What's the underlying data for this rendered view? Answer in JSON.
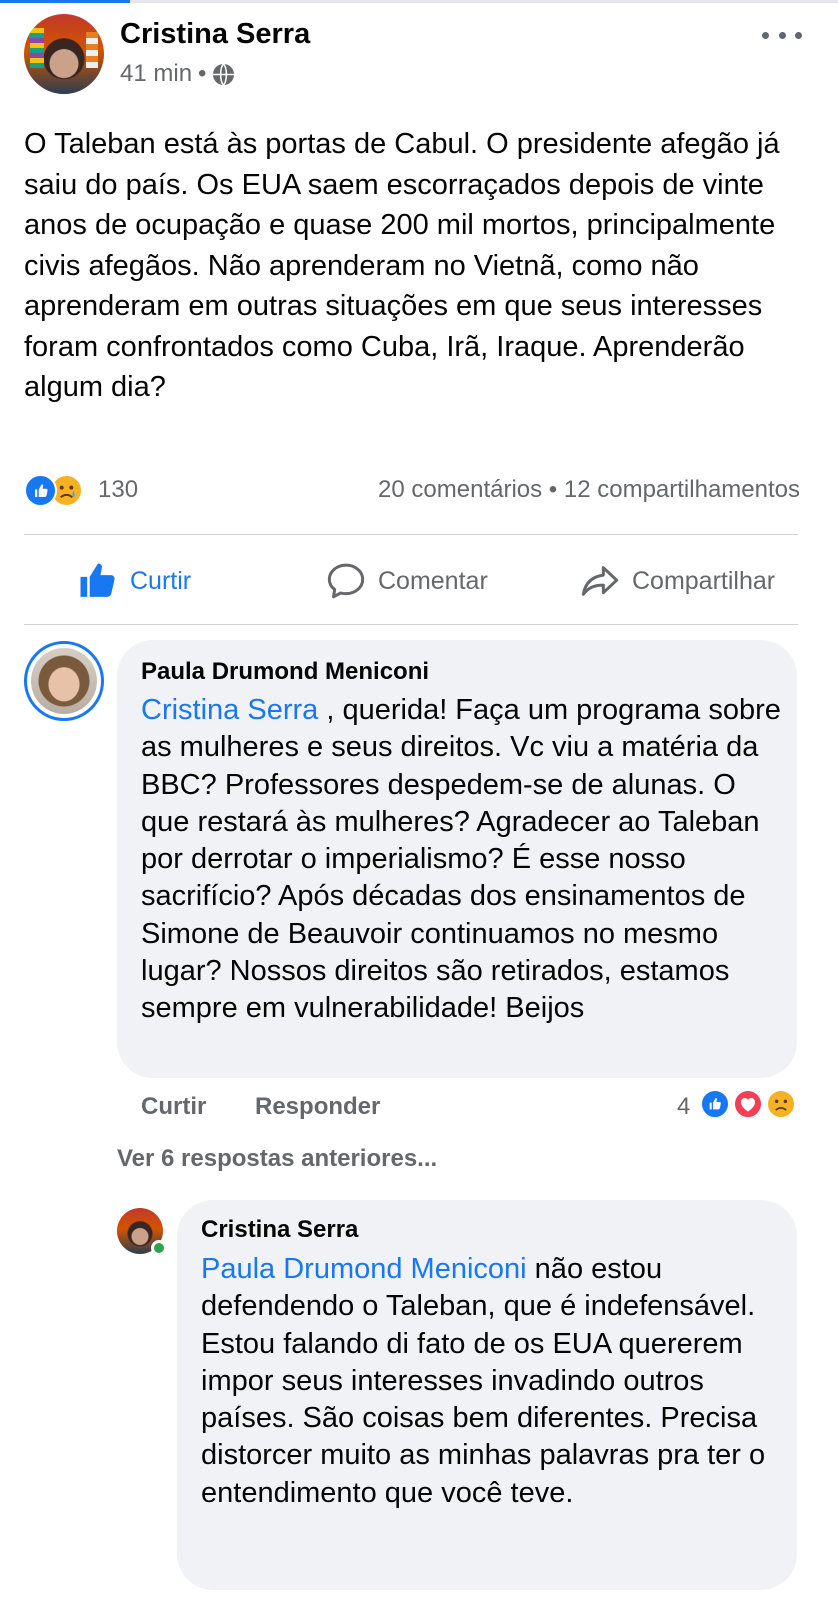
{
  "post": {
    "author": "Cristina Serra",
    "time": "41 min",
    "separator": "•",
    "text": "O Taleban está às portas de Cabul. O presidente afegão já saiu do país. Os EUA saem escorraçados depois de vinte anos de ocupação e quase 200 mil mortos, principalmente civis afegãos. Não aprenderam no Vietnã, como não aprenderam em outras situações em que seus interesses foram confrontados como Cuba, Irã, Iraque. Aprenderão algum dia?",
    "reactions": {
      "count": "130",
      "icons": [
        "like-icon",
        "sad-icon"
      ]
    },
    "stats": "20 comentários • 12 compartilhamentos"
  },
  "actions": {
    "like": "Curtir",
    "comment": "Comentar",
    "share": "Compartilhar"
  },
  "comments": [
    {
      "author": "Paula Drumond Meniconi",
      "mention": "Cristina Serra",
      "text": " , querida! Faça um programa sobre as mulheres e seus direitos.  Vc viu a matéria da BBC? Professores despedem-se de alunas. O que restará às mulheres? Agradecer ao Taleban por derrotar o imperialismo? É esse nosso sacrifício? Após décadas dos ensinamentos de Simone de Beauvoir continuamos no mesmo lugar? Nossos direitos são retirados, estamos sempre em vulnerabilidade! Beijos",
      "like_label": "Curtir",
      "reply_label": "Responder",
      "reaction_count": "4",
      "reaction_icons": [
        "like-icon",
        "love-icon",
        "sad-icon"
      ]
    }
  ],
  "view_previous": "Ver 6 respostas anteriores...",
  "reply": {
    "author": "Cristina Serra",
    "mention": "Paula Drumond Meniconi",
    "text": " não estou defendendo o Taleban, que é indefensável. Estou falando di fato de os EUA quererem impor seus interesses invadindo outros países. São coisas bem diferentes. Precisa distorcer muito as minhas palavras pra ter o entendimento que você teve."
  },
  "colors": {
    "accent": "#1877f2",
    "secondary_text": "#65676b",
    "bubble": "#f0f2f5",
    "online": "#31a24c"
  }
}
